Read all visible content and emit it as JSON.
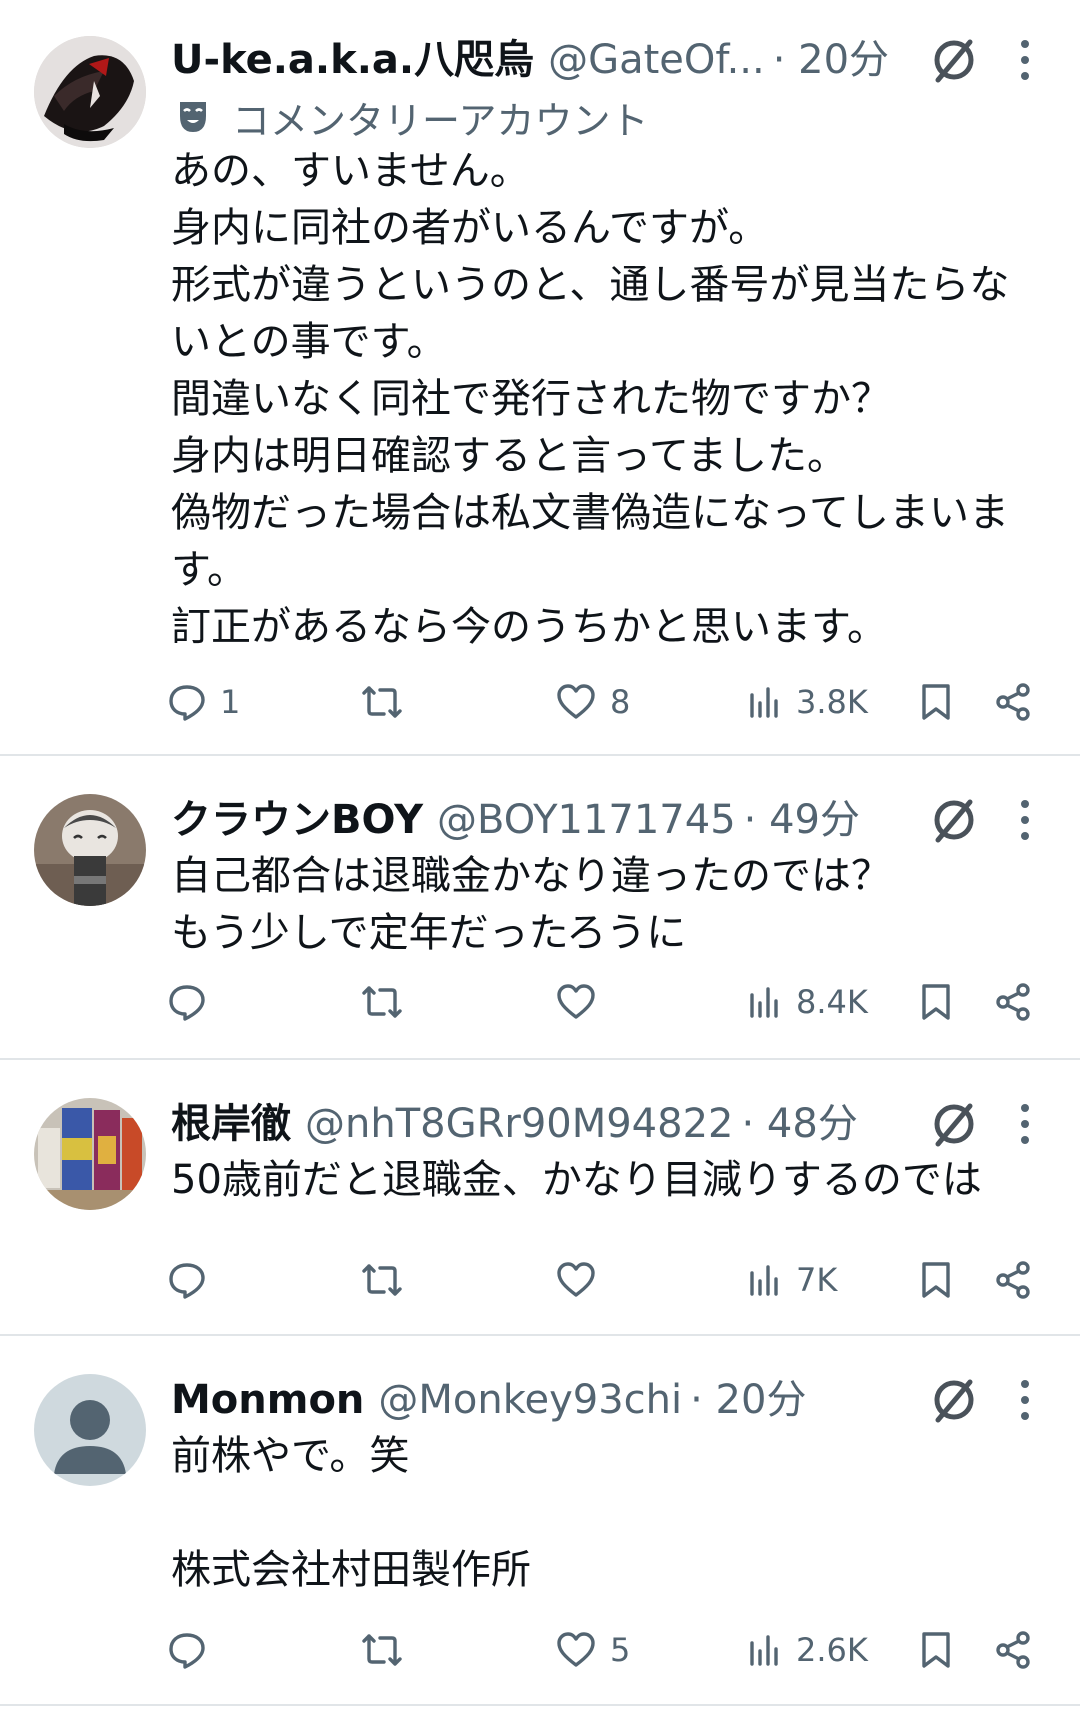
{
  "tweets": [
    {
      "name": "U-ke.a.k.a.八咫烏",
      "handle": "@GateOf...",
      "time": "· 20分",
      "badge": "コメンタリーアカウント",
      "lines": [
        "あの、すいません。",
        "身内に同社の者がいるんですが。",
        "形式が違うというのと、通し番号が見当たらな",
        "いとの事です。",
        "間違いなく同社で発行された物ですか？",
        "身内は明日確認すると言ってました。",
        "偽物だった場合は私文書偽造になってしまいま",
        "す。",
        "訂正があるなら今のうちかと思います。"
      ],
      "replies": "1",
      "retweets": "",
      "likes": "8",
      "views": "3.8K"
    },
    {
      "name": "クラウンBOY",
      "handle": "@BOY1171745",
      "time": "· 49分",
      "lines": [
        "自己都合は退職金かなり違ったのでは？",
        "もう少しで定年だったろうに"
      ],
      "replies": "",
      "retweets": "",
      "likes": "",
      "views": "8.4K"
    },
    {
      "name": "根岸徹",
      "handle": "@nhT8GRr90M94822",
      "time": "· 48分",
      "lines": [
        "50歳前だと退職金、かなり目減りするのでは"
      ],
      "replies": "",
      "retweets": "",
      "likes": "",
      "views": "7K"
    },
    {
      "name": "Monmon",
      "handle": "@Monkey93chi",
      "time": "· 20分",
      "lines": [
        "前株やで。笑",
        "",
        "株式会社村田製作所"
      ],
      "replies": "",
      "retweets": "",
      "likes": "5",
      "views": "2.6K"
    }
  ],
  "colors": {
    "text": "#0f1419",
    "secondary": "#536471",
    "divider": "#e1e5e8",
    "grok": "#4a525a"
  },
  "icons": [
    "grok-icon",
    "more-icon",
    "comedy-mask-icon",
    "reply-icon",
    "retweet-icon",
    "like-icon",
    "views-icon",
    "bookmark-icon",
    "share-icon",
    "default-avatar-icon"
  ]
}
